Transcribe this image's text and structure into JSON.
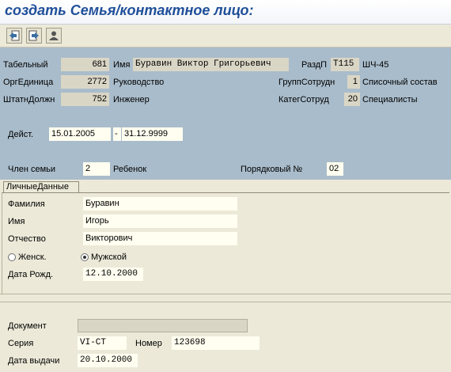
{
  "title": "создать Семья/контактное лицо:",
  "toolbar": {
    "buttons": [
      "previous-record-icon",
      "next-record-icon",
      "person-icon"
    ]
  },
  "header": {
    "tabnum_label": "Табельный",
    "tabnum_value": "681",
    "name_label": "Имя",
    "name_value": "Буравин Виктор Григорьевич",
    "razdp_label": "РаздП",
    "razdp_code": "T115",
    "razdp_text": "ШЧ-45",
    "org_label": "ОргЕдиница",
    "org_value": "2772",
    "org_text": "Руководство",
    "group_label": "ГруппСотрудн",
    "group_value": "1",
    "group_text": "Списочный состав",
    "pos_label": "ШтатнДолжн",
    "pos_value": "752",
    "pos_text": "Инженер",
    "cat_label": "КатегСотруд",
    "cat_value": "20",
    "cat_text": "Специалисты",
    "valid_label": "Дейст.",
    "valid_from": "15.01.2005",
    "valid_sep": "-",
    "valid_to": "31.12.9999",
    "member_label": "Член семьи",
    "member_value": "2",
    "member_text": "Ребенок",
    "seq_label": "Порядковый №",
    "seq_value": "02"
  },
  "personal": {
    "tab_label": "ЛичныеДанные",
    "surname_label": "Фамилия",
    "surname_value": "Буравин",
    "firstname_label": "Имя",
    "firstname_value": "Игорь",
    "patronymic_label": "Отчество",
    "patronymic_value": "Викторович",
    "female_label": "Женск.",
    "male_label": "Мужской",
    "gender_selected": "Мужской",
    "birth_label": "Дата Рожд.",
    "birth_value": "12.10.2000"
  },
  "document": {
    "doc_label": "Документ",
    "doc_value": "",
    "series_label": "Серия",
    "series_value": "VI-CT",
    "number_label": "Номер",
    "number_value": "123698",
    "issue_label": "Дата выдачи",
    "issue_value": "20.10.2000"
  },
  "colors": {
    "header_bg": "#a9bccb",
    "title_color": "#1f4f9a",
    "input_bg": "#fffef0",
    "readonly_bg": "#dad6c6"
  }
}
